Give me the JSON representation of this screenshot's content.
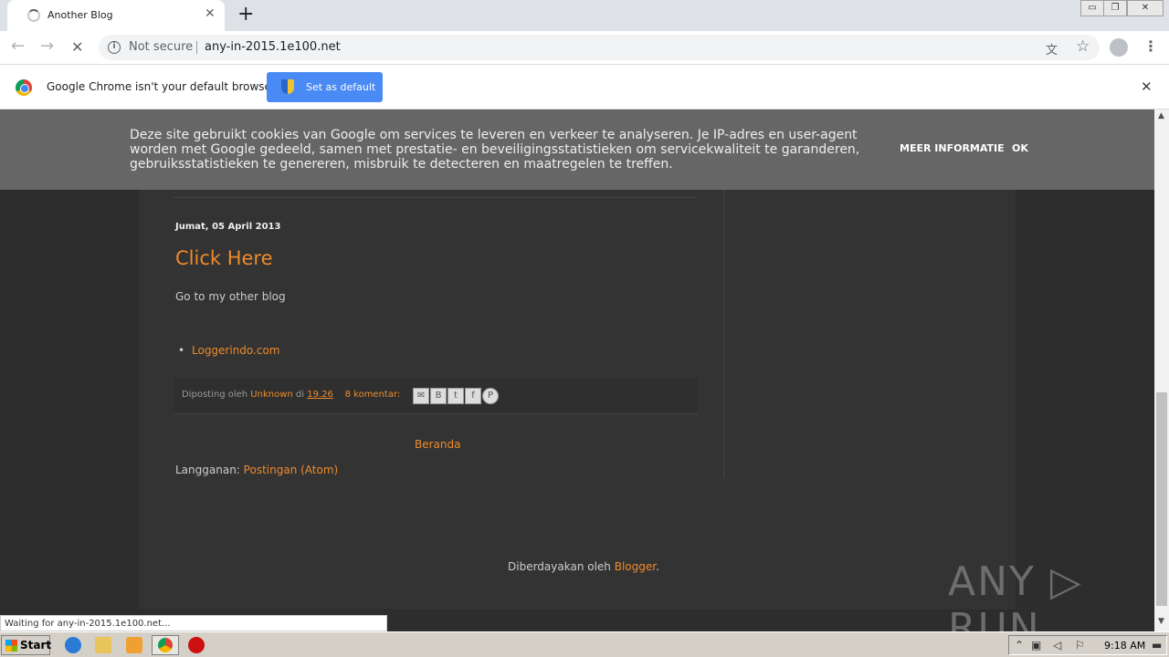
{
  "browser": {
    "tab_title": "Another Blog",
    "tab_close": "✕",
    "new_tab": "+",
    "window_controls": [
      "▭",
      "❐",
      "✕"
    ],
    "nav": {
      "back": "←",
      "forward": "→",
      "stop": "✕"
    },
    "security_label": "Not secure",
    "url": "any-in-2015.1e100.net",
    "menu_glyph": "⋮"
  },
  "infobar": {
    "message": "Google Chrome isn't your default browser",
    "button_label": "Set as default",
    "close": "✕"
  },
  "cookie_banner": {
    "text": "Deze site gebruikt cookies van Google om services te leveren en verkeer te analyseren. Je IP-adres en user-agent worden met Google gedeeld, samen met prestatie- en beveiligingsstatistieken om servicekwaliteit te garanderen, gebruiksstatistieken te genereren, misbruik te detecteren en maatregelen te treffen.",
    "more_info": "MEER INFORMATIE",
    "ok": "OK"
  },
  "post": {
    "date": "Jumat, 05 April 2013",
    "title": "Click Here",
    "body": "Go to my other blog",
    "list_item": "Loggerindo.com",
    "meta_posted_by": "Diposting oleh",
    "meta_author": "Unknown",
    "meta_at": "di",
    "meta_time": "19.26",
    "meta_comments": "8 komentar:",
    "share": [
      "✉",
      "B",
      "t",
      "f",
      "P"
    ]
  },
  "blog_nav": {
    "home": "Beranda",
    "subscribe_label": "Langganan:",
    "subscribe_link": "Postingan (Atom)"
  },
  "footer": {
    "powered_by": "Diberdayakan oleh",
    "blogger": "Blogger",
    "period": "."
  },
  "watermark": "ANY ▷ RUN",
  "status": "Waiting for any-in-2015.1e100.net...",
  "taskbar": {
    "start": "Start",
    "clock": "9:18 AM"
  },
  "colors": {
    "accent_link": "#ee8a2b",
    "chrome_blue": "#4a8af4"
  }
}
